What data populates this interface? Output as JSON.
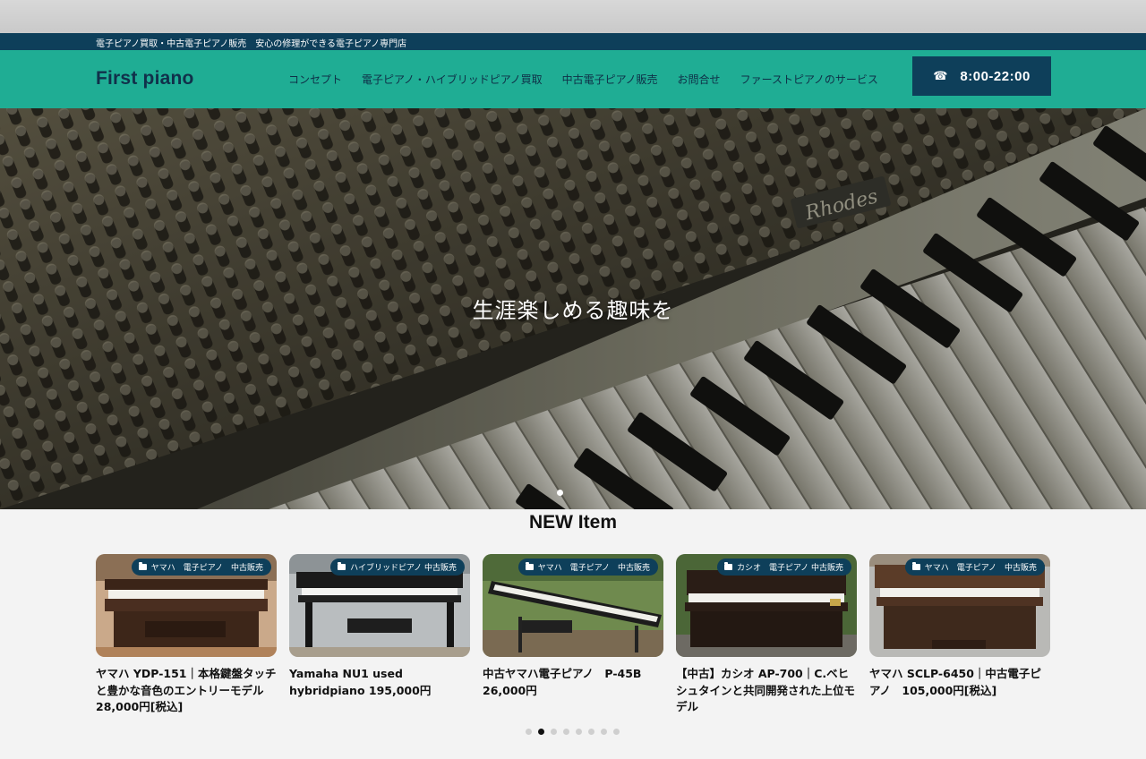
{
  "topbar": {
    "tagline": "電子ピアノ買取・中古電子ピアノ販売　安心の修理ができる電子ピアノ専門店"
  },
  "header": {
    "logo": "First piano",
    "nav": [
      {
        "label": "コンセプト"
      },
      {
        "label": "電子ピアノ・ハイブリッドピアノ買取"
      },
      {
        "label": "中古電子ピアノ販売"
      },
      {
        "label": "お問合せ"
      },
      {
        "label": "ファーストピアノのサービス"
      }
    ],
    "phone": {
      "icon": "phone-icon",
      "glyph": "☎",
      "hours": "8:00-22:00"
    }
  },
  "hero": {
    "caption": "生涯楽しめる趣味を",
    "brand_plate": "Rhodes",
    "slide_count": 1,
    "active_slide": 1
  },
  "new_items": {
    "title": "NEW Item",
    "cards": [
      {
        "badge": "ヤマハ　電子ピアノ　中古販売",
        "title": "ヤマハ YDP-151｜本格鍵盤タッチと豊かな音色のエントリーモデル 28,000円[税込]"
      },
      {
        "badge": "ハイブリッドピアノ 中古販売",
        "title": "Yamaha NU1 used hybridpiano 195,000円"
      },
      {
        "badge": "ヤマハ　電子ピアノ　中古販売",
        "title": "中古ヤマハ電子ピアノ　P-45B　26,000円"
      },
      {
        "badge": "カシオ　電子ピアノ 中古販売",
        "title": "【中古】カシオ AP-700｜C.ベヒシュタインと共同開発された上位モデル"
      },
      {
        "badge": "ヤマハ　電子ピアノ　中古販売",
        "title": "ヤマハ SCLP-6450｜中古電子ピアノ　105,000円[税込]"
      }
    ],
    "pager": {
      "count": 8,
      "active": 2
    }
  },
  "colors": {
    "topbar": "#0e3f5a",
    "header": "#1fad94",
    "accent_dark": "#0e3f5a"
  }
}
